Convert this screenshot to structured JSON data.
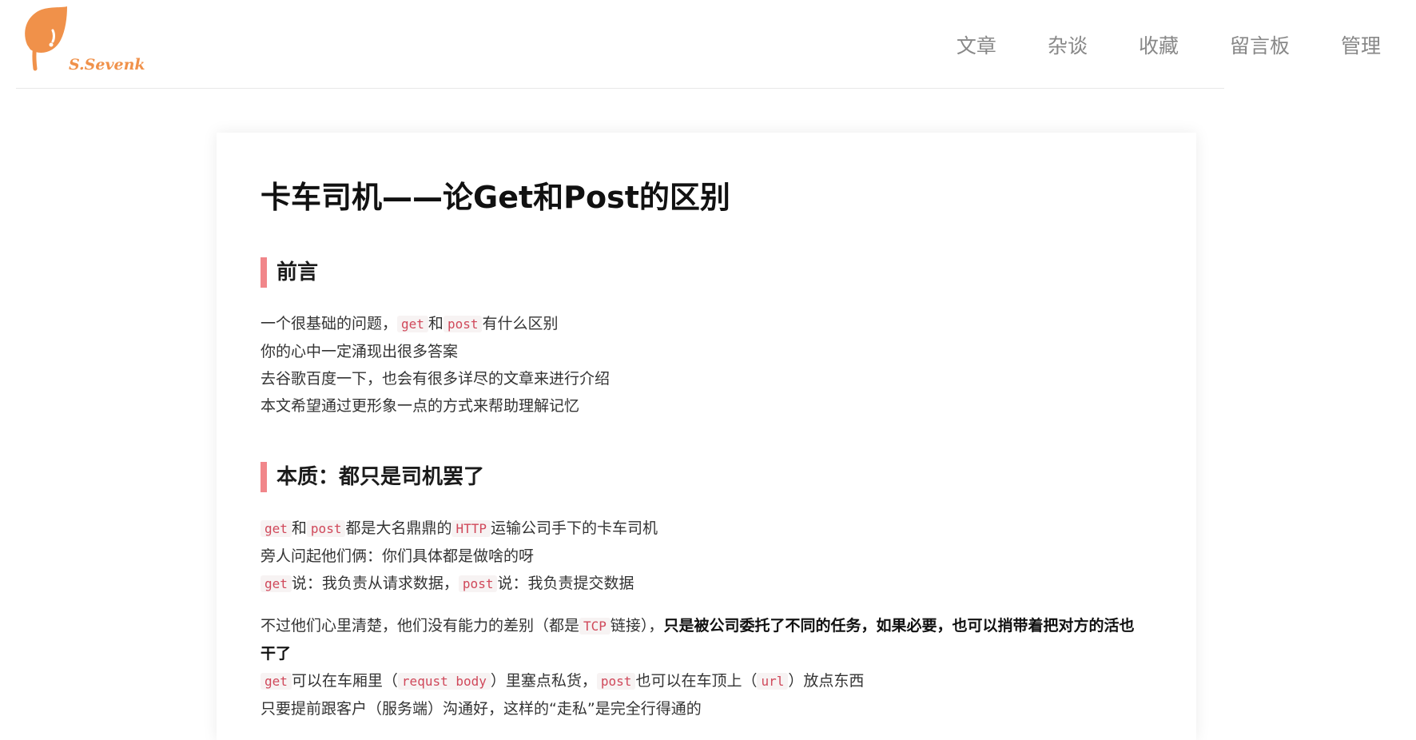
{
  "brand": {
    "name": "S.Sevenk",
    "accent": "#f0914a"
  },
  "nav": [
    {
      "label": "文章"
    },
    {
      "label": "杂谈"
    },
    {
      "label": "收藏"
    },
    {
      "label": "留言板"
    },
    {
      "label": "管理"
    }
  ],
  "article": {
    "title": "卡车司机——论Get和Post的区别",
    "sections": [
      {
        "heading": "前言",
        "lines": [
          {
            "a": "一个很基础的问题，",
            "c1": "get",
            "b": "和",
            "c2": "post",
            "d": "有什么区别"
          },
          "你的心中一定涌现出很多答案",
          "去谷歌百度一下，也会有很多详尽的文章来进行介绍",
          "本文希望通过更形象一点的方式来帮助理解记忆"
        ]
      },
      {
        "heading": "本质：都只是司机罢了",
        "p1": [
          {
            "c1": "get",
            "a": "和",
            "c2": "post",
            "b": "都是大名鼎鼎的",
            "c3": "HTTP",
            "d": "运输公司手下的卡车司机"
          },
          "旁人问起他们俩：你们具体都是做啥的呀",
          {
            "c1": "get",
            "a": "说：我负责从请求数据，",
            "c2": "post",
            "b": "说：我负责提交数据"
          }
        ],
        "p2": {
          "l1a": "不过他们心里清楚，他们没有能力的差别（都是",
          "l1code": "TCP",
          "l1b": "链接），",
          "l1strong": "只是被公司委托了不同的任务，如果必要，也可以捎带着把对方的活也",
          "l2strong": "干了",
          "l3": {
            "c1": "get",
            "a": "可以在车厢里（",
            "c2": "requst body",
            "b": "）里塞点私货，",
            "c3": "post",
            "d": "也可以在车顶上（",
            "c4": "url",
            "e": "）放点东西"
          },
          "l4": "只要提前跟客户（服务端）沟通好，这样的“走私”是完全行得通的"
        }
      }
    ]
  },
  "colors": {
    "heading_bar": "#f1868a",
    "code_text": "#d0485a",
    "nav_text": "#888888"
  }
}
